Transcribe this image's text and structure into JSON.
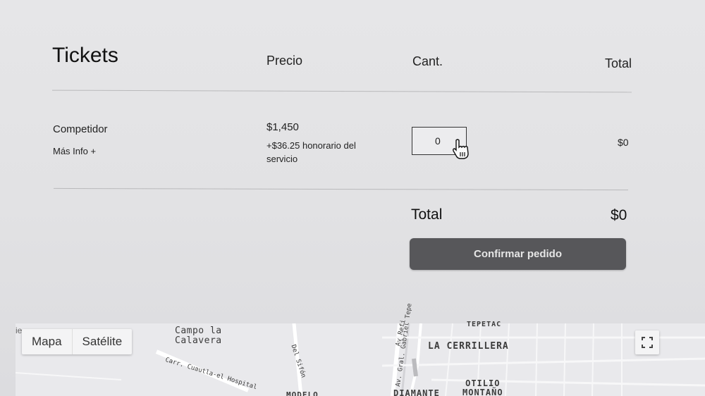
{
  "header": {
    "tickets": "Tickets",
    "precio": "Precio",
    "cant": "Cant.",
    "total": "Total"
  },
  "ticket": {
    "name": "Competidor",
    "info_link": "Más Info +",
    "price": "$1,450",
    "fee": "+$36.25 honorario del servicio",
    "quantity": "0",
    "line_total": "$0"
  },
  "summary": {
    "label": "Total",
    "value": "$0",
    "confirm_label": "Confirmar pedido"
  },
  "map": {
    "edge_text": "ie",
    "buttons": {
      "map": "Mapa",
      "satellite": "Satélite"
    },
    "labels": {
      "campo": "Campo la\nCalavera",
      "carr": "Carr. Cuautla-el Hospital",
      "sifon": "Del Sifón",
      "av_ref": "Av Refi",
      "av_gral": "Av. Gral. Gabriel Tepe",
      "cerrillera": "LA CERRILLERA",
      "tepe": "TEPETAC",
      "otilio": "OTILIO\nMONTAÑO",
      "diamante": "DIAMANTE",
      "modelo": "MODELO"
    },
    "fullscreen_icon": "fullscreen-icon"
  },
  "colors": {
    "background": "#e4e4e6",
    "button": "#57575a",
    "button_text": "#e6e6e6",
    "map_bg": "#e9e9ec"
  }
}
